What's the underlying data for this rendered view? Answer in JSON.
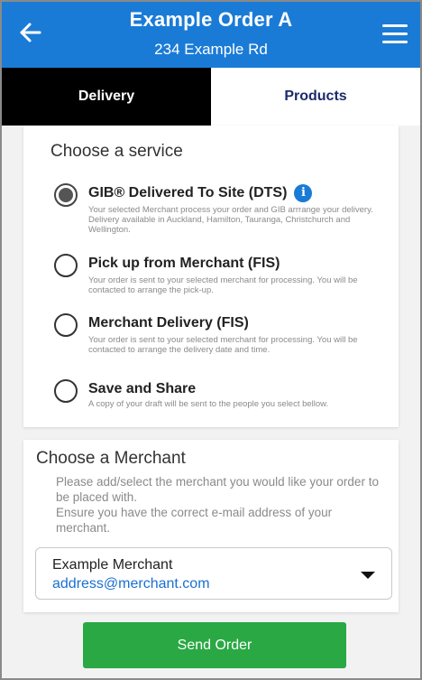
{
  "header": {
    "title": "Example Order A",
    "subtitle": "234 Example Rd",
    "back_icon": "arrow-left-icon",
    "menu_icon": "hamburger-menu-icon",
    "color": "#1a7bd6"
  },
  "tabs": [
    {
      "label": "Delivery",
      "active": true
    },
    {
      "label": "Products",
      "active": false
    }
  ],
  "service": {
    "title": "Choose a service",
    "options": [
      {
        "label": "GIB® Delivered To Site (DTS)",
        "description": "Your selected Merchant process your order and GIB arrrange your delivery. Delivery available in Auckland, Hamilton, Tauranga, Christchurch and Wellington.",
        "selected": true,
        "info_icon": "i"
      },
      {
        "label": "Pick up from Merchant (FIS)",
        "description": "Your order is sent to your selected merchant for processing. You will be contacted to arrange the pick-up.",
        "selected": false
      },
      {
        "label": "Merchant Delivery (FIS)",
        "description": "Your order is sent to your selected merchant for processing. You will be contacted to arrange the delivery date and time.",
        "selected": false
      },
      {
        "label": "Save and Share",
        "description": "A copy of your draft will be sent to the people you select bellow.",
        "selected": false
      }
    ]
  },
  "merchant": {
    "title": "Choose a Merchant",
    "info_line1": "Please add/select the merchant you would like your order to be placed with.",
    "info_line2": "Ensure you have the correct e-mail address of your merchant.",
    "selected_name": "Example Merchant",
    "selected_email": "address@merchant.com"
  },
  "actions": {
    "send_label": "Send Order",
    "send_color": "#2aa844"
  }
}
